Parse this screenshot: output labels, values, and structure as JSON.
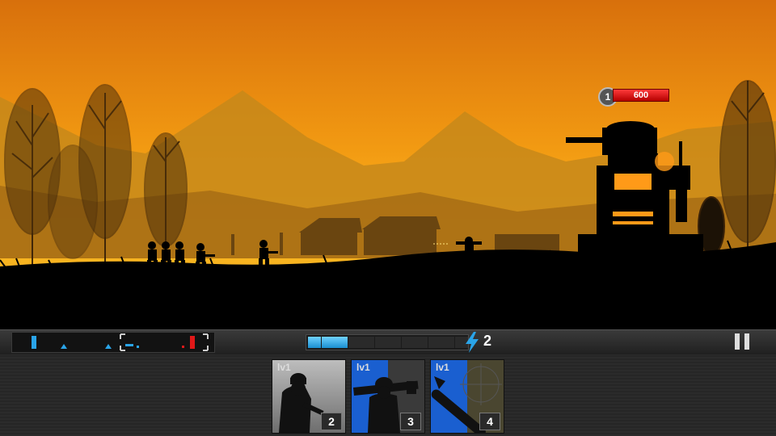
{
  "colors": {
    "sky_top": "#e07a10",
    "sky_bottom": "#ffc020",
    "hp_red": "#e01818",
    "energy_blue": "#2aa4e8",
    "ally_blue": "#1a5fd0"
  },
  "enemy_tower": {
    "level": "1",
    "hp": "600"
  },
  "energy": {
    "count": "2",
    "filled_segments": 3,
    "total_segments": 12,
    "icon": "lightning-icon"
  },
  "pause": {
    "icon": "pause-icon"
  },
  "cards": [
    {
      "level": "lv1",
      "cost": "2",
      "unit": "rifleman",
      "icon": "soldier-rifle-icon",
      "charge": 0
    },
    {
      "level": "lv1",
      "cost": "3",
      "unit": "rocket soldier",
      "icon": "soldier-bazooka-icon",
      "charge": 0.5
    },
    {
      "level": "lv1",
      "cost": "4",
      "unit": "missile strike",
      "icon": "missile-icon",
      "charge": 0.5
    }
  ]
}
